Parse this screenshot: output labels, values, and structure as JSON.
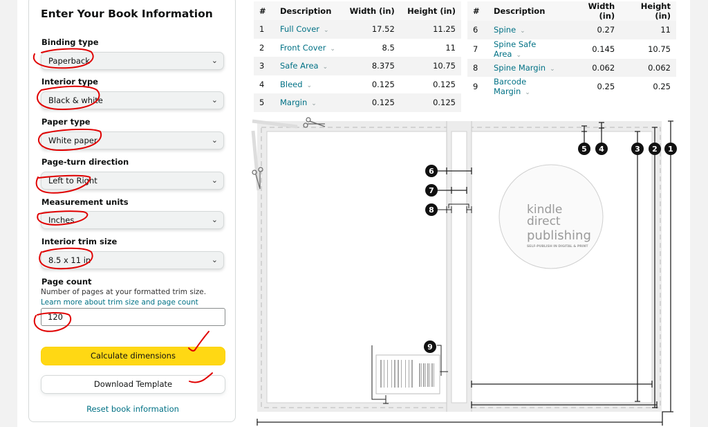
{
  "form": {
    "title": "Enter Your Book Information",
    "binding_type": {
      "label": "Binding type",
      "value": "Paperback"
    },
    "interior_type": {
      "label": "Interior type",
      "value": "Black & white"
    },
    "paper_type": {
      "label": "Paper type",
      "value": "White paper"
    },
    "page_turn": {
      "label": "Page-turn direction",
      "value": "Left to Right"
    },
    "units": {
      "label": "Measurement units",
      "value": "Inches"
    },
    "trim_size": {
      "label": "Interior trim size",
      "value": "8.5 x 11 in"
    },
    "page_count": {
      "label": "Page count",
      "helper": "Number of pages at your formatted trim size.",
      "link": "Learn more about trim size and page count",
      "value": "120"
    },
    "calculate_label": "Calculate dimensions",
    "download_label": "Download Template",
    "reset_label": "Reset book information",
    "chevron": "⌄"
  },
  "tables": {
    "headers": [
      "#",
      "Description",
      "Width (in)",
      "Height (in)"
    ],
    "left": [
      {
        "n": "1",
        "desc": "Full Cover",
        "w": "17.52",
        "h": "11.25"
      },
      {
        "n": "2",
        "desc": "Front Cover",
        "w": "8.5",
        "h": "11"
      },
      {
        "n": "3",
        "desc": "Safe Area",
        "w": "8.375",
        "h": "10.75"
      },
      {
        "n": "4",
        "desc": "Bleed",
        "w": "0.125",
        "h": "0.125"
      },
      {
        "n": "5",
        "desc": "Margin",
        "w": "0.125",
        "h": "0.125"
      }
    ],
    "right": [
      {
        "n": "6",
        "desc": "Spine",
        "w": "0.27",
        "h": "11"
      },
      {
        "n": "7",
        "desc": "Spine Safe Area",
        "w": "0.145",
        "h": "10.75"
      },
      {
        "n": "8",
        "desc": "Spine Margin",
        "w": "0.062",
        "h": "0.062"
      },
      {
        "n": "9",
        "desc": "Barcode Margin",
        "w": "0.25",
        "h": "0.25"
      }
    ]
  },
  "diagram": {
    "markers": [
      "1",
      "2",
      "3",
      "4",
      "5",
      "6",
      "7",
      "8",
      "9"
    ],
    "logo": {
      "line1": "kindle",
      "line2": "direct",
      "line3": "publishing",
      "tagline": "SELF-PUBLISH IN DIGITAL & PRINT"
    }
  },
  "colors": {
    "link": "#007185",
    "primary_button": "#ffd814",
    "annotation": "#e00000"
  }
}
